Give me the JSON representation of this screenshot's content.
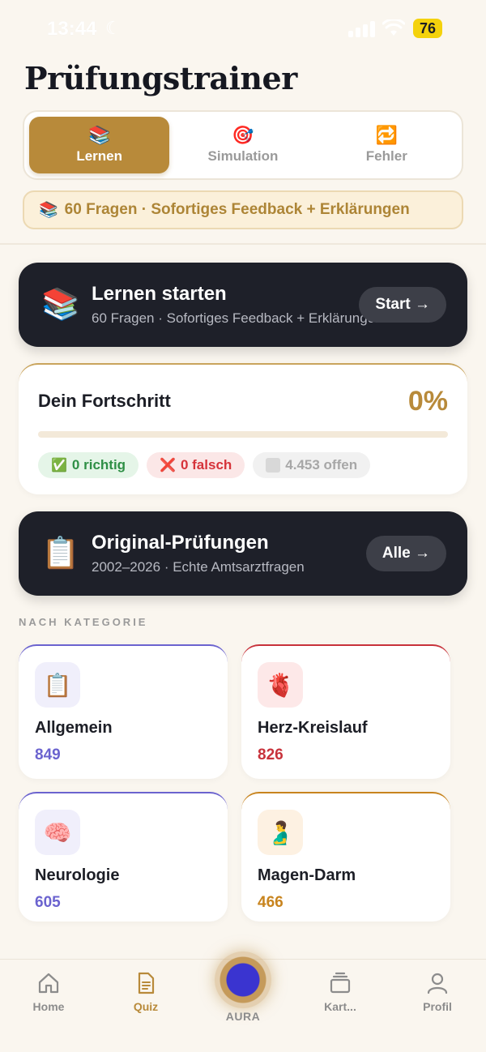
{
  "status_bar": {
    "time": "13:44",
    "battery": "76"
  },
  "page_title": "Prüfungstrainer",
  "mode_tabs": [
    {
      "label": "Lernen",
      "icon": "📚",
      "active": true
    },
    {
      "label": "Simulation",
      "icon": "🎯",
      "active": false
    },
    {
      "label": "Fehler",
      "icon": "🔁",
      "active": false
    }
  ],
  "info_banner": {
    "icon": "📚",
    "text": "60 Fragen · Sofortiges Feedback + Erklärungen"
  },
  "learn_card": {
    "icon": "📚",
    "title": "Lernen starten",
    "subtitle": "60 Fragen · Sofortiges Feedback + Erklärungen",
    "button": "Start →"
  },
  "progress": {
    "title": "Dein Fortschritt",
    "percent_label": "0%",
    "percent": 0,
    "correct_icon": "✅",
    "correct": "0 richtig",
    "wrong_icon": "❌",
    "wrong": "0 falsch",
    "open": "4.453 offen"
  },
  "exam_card": {
    "icon": "📋",
    "title": "Original-Prüfungen",
    "subtitle": "2002–2026 · Echte Amtsarztfragen",
    "button": "Alle →"
  },
  "section_label": "NACH KATEGORIE",
  "categories": [
    {
      "name": "Allgemein",
      "count": "849",
      "icon": "📋",
      "color": "#6b63cf",
      "tint": "#f0effb"
    },
    {
      "name": "Herz-Kreislauf",
      "count": "826",
      "icon": "🫀",
      "color": "#c8323b",
      "tint": "#fde8e8"
    },
    {
      "name": "Neurologie",
      "count": "605",
      "icon": "🧠",
      "color": "#6b63cf",
      "tint": "#f0effb"
    },
    {
      "name": "Magen-Darm",
      "count": "466",
      "icon": "🫃",
      "color": "#c8841e",
      "tint": "#fdf1e2"
    }
  ],
  "bottom_nav": {
    "home": "Home",
    "quiz": "Quiz",
    "aura": "AURA",
    "cards": "Kart...",
    "profile": "Profil"
  }
}
